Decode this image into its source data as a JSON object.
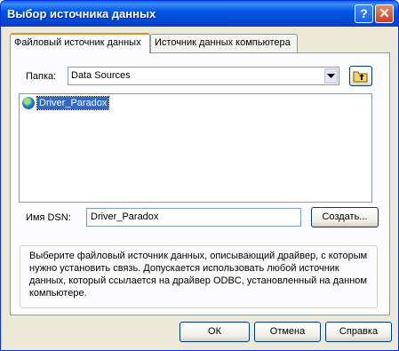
{
  "window": {
    "title": "Выбор источника данных",
    "help_glyph": "?",
    "close_glyph": "✕"
  },
  "tabs": [
    {
      "label": "Файловый источник данных",
      "active": true
    },
    {
      "label": "Источник данных компьютера",
      "active": false
    }
  ],
  "folder": {
    "label": "Папка:",
    "value": "Data Sources",
    "dropdown_icon": "chevron-down-icon",
    "up_folder_icon": "folder-up-icon"
  },
  "list": {
    "items": [
      {
        "name": "Driver_Paradox",
        "icon": "globe-icon",
        "selected": true
      }
    ]
  },
  "dsn": {
    "label": "Имя DSN:",
    "value": "Driver_Paradox",
    "create_button": "Создать..."
  },
  "info_text": "Выберите файловый источник данных, описывающий драйвер, с которым нужно установить связь.  Допускается использовать любой источник данных, который ссылается на драйвер ODBC, установленный на данном компьютере.",
  "buttons": {
    "ok": "ОК",
    "cancel": "Отмена",
    "help": "Справка"
  },
  "colors": {
    "titlebar": "#0055e5",
    "dialog_bg": "#ece9d8",
    "selection": "#316ac5",
    "tab_highlight": "#e68b2c"
  }
}
